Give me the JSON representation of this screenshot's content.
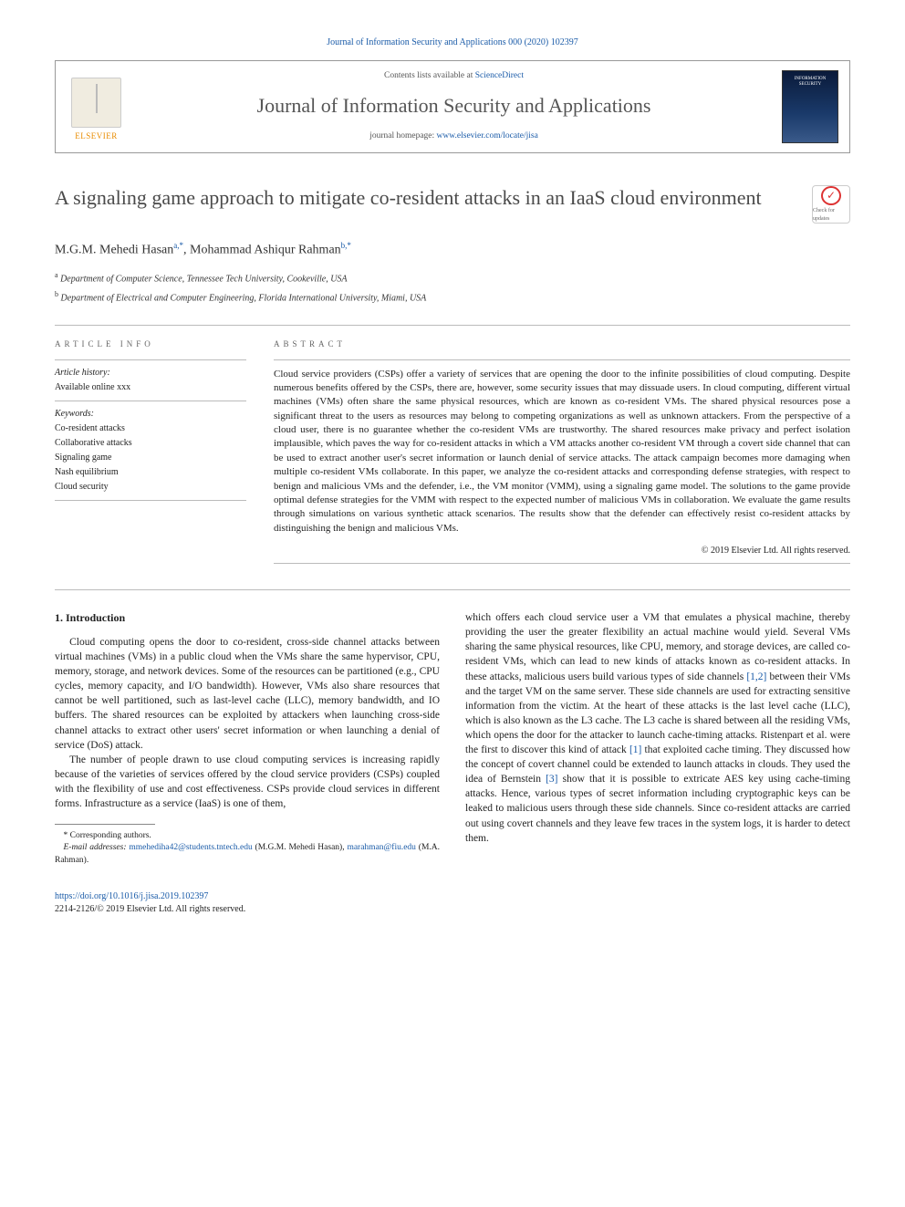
{
  "top_reference": "Journal of Information Security and Applications 000 (2020) 102397",
  "header": {
    "publisher": "ELSEVIER",
    "contents_prefix": "Contents lists available at ",
    "contents_link": "ScienceDirect",
    "journal_name": "Journal of Information Security and Applications",
    "homepage_prefix": "journal homepage: ",
    "homepage_url": "www.elsevier.com/locate/jisa",
    "cover_text": "INFORMATION SECURITY"
  },
  "title": "A signaling game approach to mitigate co-resident attacks in an IaaS cloud environment",
  "check_badge": "Check for updates",
  "authors": [
    {
      "name": "M.G.M. Mehedi Hasan",
      "marks": "a,*"
    },
    {
      "name": "Mohammad Ashiqur Rahman",
      "marks": "b,*"
    }
  ],
  "affiliations": [
    {
      "mark": "a",
      "text": "Department of Computer Science, Tennessee Tech University, Cookeville, USA"
    },
    {
      "mark": "b",
      "text": "Department of Electrical and Computer Engineering, Florida International University, Miami, USA"
    }
  ],
  "article_info_label": "ARTICLE INFO",
  "abstract_label": "ABSTRACT",
  "history_label": "Article history:",
  "history_value": "Available online xxx",
  "keywords_label": "Keywords:",
  "keywords": [
    "Co-resident attacks",
    "Collaborative attacks",
    "Signaling game",
    "Nash equilibrium",
    "Cloud security"
  ],
  "abstract": "Cloud service providers (CSPs) offer a variety of services that are opening the door to the infinite possibilities of cloud computing. Despite numerous benefits offered by the CSPs, there are, however, some security issues that may dissuade users. In cloud computing, different virtual machines (VMs) often share the same physical resources, which are known as co-resident VMs. The shared physical resources pose a significant threat to the users as resources may belong to competing organizations as well as unknown attackers. From the perspective of a cloud user, there is no guarantee whether the co-resident VMs are trustworthy. The shared resources make privacy and perfect isolation implausible, which paves the way for co-resident attacks in which a VM attacks another co-resident VM through a covert side channel that can be used to extract another user's secret information or launch denial of service attacks. The attack campaign becomes more damaging when multiple co-resident VMs collaborate. In this paper, we analyze the co-resident attacks and corresponding defense strategies, with respect to benign and malicious VMs and the defender, i.e., the VM monitor (VMM), using a signaling game model. The solutions to the game provide optimal defense strategies for the VMM with respect to the expected number of malicious VMs in collaboration. We evaluate the game results through simulations on various synthetic attack scenarios. The results show that the defender can effectively resist co-resident attacks by distinguishing the benign and malicious VMs.",
  "copyright": "© 2019 Elsevier Ltd. All rights reserved.",
  "intro_heading": "1. Introduction",
  "intro_p1": "Cloud computing opens the door to co-resident, cross-side channel attacks between virtual machines (VMs) in a public cloud when the VMs share the same hypervisor, CPU, memory, storage, and network devices. Some of the resources can be partitioned (e.g., CPU cycles, memory capacity, and I/O bandwidth). However, VMs also share resources that cannot be well partitioned, such as last-level cache (LLC), memory bandwidth, and IO buffers. The shared resources can be exploited by attackers when launching cross-side channel attacks to extract other users' secret information or when launching a denial of service (DoS) attack.",
  "intro_p2": "The number of people drawn to use cloud computing services is increasing rapidly because of the varieties of services offered by the cloud service providers (CSPs) coupled with the flexibility of use and cost effectiveness. CSPs provide cloud services in different forms. Infrastructure as a service (IaaS) is one of them,",
  "intro_p3_a": "which offers each cloud service user a VM that emulates a physical machine, thereby providing the user the greater flexibility an actual machine would yield. Several VMs sharing the same physical resources, like CPU, memory, and storage devices, are called co-resident VMs, which can lead to new kinds of attacks known as co-resident attacks. In these attacks, malicious users build various types of side channels ",
  "intro_cite1": "[1,2]",
  "intro_p3_b": " between their VMs and the target VM on the same server. These side channels are used for extracting sensitive information from the victim. At the heart of these attacks is the last level cache (LLC), which is also known as the L3 cache. The L3 cache is shared between all the residing VMs, which opens the door for the attacker to launch cache-timing attacks. Ristenpart et al. were the first to discover this kind of attack ",
  "intro_cite2": "[1]",
  "intro_p3_c": " that exploited cache timing. They discussed how the concept of covert channel could be extended to launch attacks in clouds. They used the idea of Bernstein ",
  "intro_cite3": "[3]",
  "intro_p3_d": " show that it is possible to extricate AES key using cache-timing attacks. Hence, various types of secret information including cryptographic keys can be leaked to malicious users through these side channels. Since co-resident attacks are carried out using covert channels and they leave few traces in the system logs, it is harder to detect them.",
  "footnote_star": "* Corresponding authors.",
  "footnote_email_label": "E-mail addresses: ",
  "footnote_email1": "mmehediha42@students.tntech.edu",
  "footnote_email1_who": " (M.G.M. Mehedi Hasan), ",
  "footnote_email2": "marahman@fiu.edu",
  "footnote_email2_who": " (M.A. Rahman).",
  "doi": "https://doi.org/10.1016/j.jisa.2019.102397",
  "issn_line": "2214-2126/© 2019 Elsevier Ltd. All rights reserved."
}
